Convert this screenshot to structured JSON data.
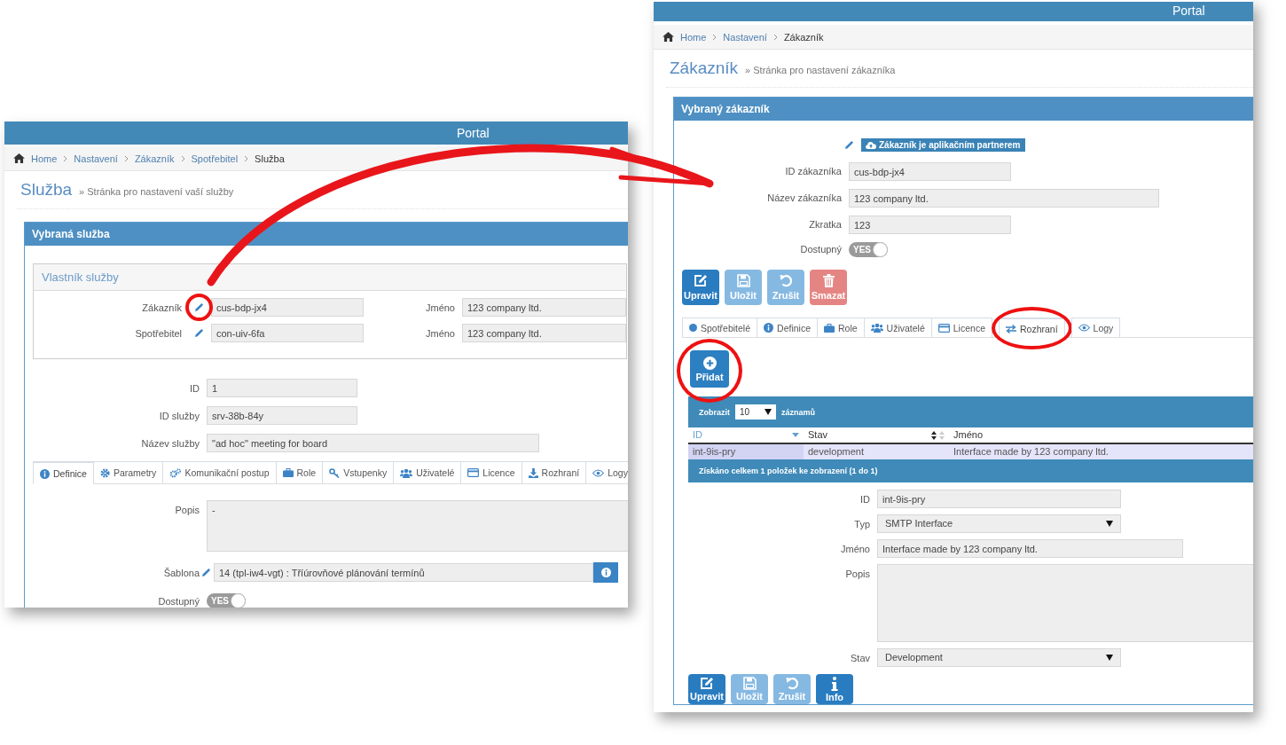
{
  "left_window": {
    "header": {
      "title": "Portal"
    },
    "breadcrumb": [
      {
        "label": "Home",
        "current": false
      },
      {
        "label": "Nastavení",
        "current": false
      },
      {
        "label": "Zákazník",
        "current": false
      },
      {
        "label": "Spotřebitel",
        "current": false
      },
      {
        "label": "Služba",
        "current": true
      }
    ],
    "page_title": "Služba",
    "page_subtitle": "» Stránka pro nastavení vaší služby",
    "panel_title": "Vybraná služba",
    "owner": {
      "title": "Vlastník služby",
      "rows": [
        {
          "label": "Zákazník",
          "value": "cus-bdp-jx4",
          "name_label": "Jméno",
          "name_value": "123 company ltd.",
          "circled": true
        },
        {
          "label": "Spotřebitel",
          "value": "con-uiv-6fa",
          "name_label": "Jméno",
          "name_value": "123 company ltd.",
          "circled": false
        }
      ]
    },
    "fields": [
      {
        "label": "ID",
        "value": "1"
      },
      {
        "label": "ID služby",
        "value": "srv-38b-84y"
      },
      {
        "label": "Název služby",
        "value": "\"ad hoc\" meeting for board"
      }
    ],
    "tabs": [
      {
        "label": "Definice",
        "selected": true
      },
      {
        "label": "Parametry",
        "selected": false
      },
      {
        "label": "Komunikační postup",
        "selected": false
      },
      {
        "label": "Role",
        "selected": false
      },
      {
        "label": "Vstupenky",
        "selected": false
      },
      {
        "label": "Uživatelé",
        "selected": false
      },
      {
        "label": "Licence",
        "selected": false
      },
      {
        "label": "Rozhraní",
        "selected": false
      },
      {
        "label": "Logy",
        "selected": false
      }
    ],
    "description": {
      "label": "Popis",
      "value": "-"
    },
    "template": {
      "label": "Šablona",
      "value": "14 (tpl-iw4-vgt) : Tříúrovňové plánování termínů"
    },
    "available": {
      "label": "Dostupný",
      "text": "YES",
      "on": true
    }
  },
  "right_window": {
    "header": {
      "title": "Portal"
    },
    "breadcrumb": [
      {
        "label": "Home",
        "current": false
      },
      {
        "label": "Nastavení",
        "current": false
      },
      {
        "label": "Zákazník",
        "current": true
      }
    ],
    "page_title": "Zákazník",
    "page_subtitle": "» Stránka pro nastavení zákazníka",
    "panel_title": "Vybraný zákazník",
    "partner_badge": "Zákazník je aplikačním partnerem",
    "fields": [
      {
        "label": "ID zákazníka",
        "value": "cus-bdp-jx4"
      },
      {
        "label": "Název zákazníka",
        "value": "123 company ltd."
      },
      {
        "label": "Zkratka",
        "value": "123"
      }
    ],
    "available": {
      "label": "Dostupný",
      "text": "YES",
      "on": true
    },
    "actions": [
      {
        "label": "Upravit",
        "kind": "primary",
        "disabled": false
      },
      {
        "label": "Uložit",
        "kind": "primary",
        "disabled": true
      },
      {
        "label": "Zrušit",
        "kind": "primary",
        "disabled": true
      },
      {
        "label": "Smazat",
        "kind": "danger",
        "disabled": true
      }
    ],
    "tabs": [
      {
        "label": "Spotřebitelé",
        "selected": false,
        "circled": false
      },
      {
        "label": "Definice",
        "selected": false,
        "circled": false
      },
      {
        "label": "Role",
        "selected": false,
        "circled": false
      },
      {
        "label": "Uživatelé",
        "selected": false,
        "circled": false
      },
      {
        "label": "Licence",
        "selected": false,
        "circled": false
      },
      {
        "label": "Rozhraní",
        "selected": true,
        "circled": true
      },
      {
        "label": "Logy",
        "selected": false,
        "circled": false
      }
    ],
    "add_button": {
      "label": "Přidat",
      "circled": true
    },
    "table": {
      "length_label": "Zobrazit",
      "length_value": "10",
      "length_suffix": "záznamů",
      "columns": [
        {
          "label": "ID",
          "sorted": true
        },
        {
          "label": "Stav",
          "sorted": false,
          "sortable": true
        },
        {
          "label": "Jméno",
          "sorted": false,
          "sortable": false
        }
      ],
      "rows": [
        {
          "cells": [
            "int-9is-pry",
            "development",
            "Interface made by 123 company ltd."
          ],
          "selected": true
        }
      ],
      "info": "Získáno celkem 1 položek ke zobrazení (1 do 1)"
    },
    "detail_fields": [
      {
        "label": "ID",
        "value": "int-9is-pry",
        "kind": "text"
      },
      {
        "label": "Typ",
        "value": "SMTP Interface",
        "kind": "select"
      },
      {
        "label": "Jméno",
        "value": "Interface made by 123 company ltd.",
        "kind": "text"
      },
      {
        "label": "Popis",
        "kind": "textarea"
      },
      {
        "label": "Stav",
        "value": "Development",
        "kind": "select"
      }
    ],
    "detail_actions": [
      {
        "label": "Upravit",
        "kind": "primary",
        "disabled": false
      },
      {
        "label": "Uložit",
        "kind": "primary",
        "disabled": true
      },
      {
        "label": "Zrušit",
        "kind": "primary",
        "disabled": true
      },
      {
        "label": "Info",
        "kind": "primary",
        "disabled": false
      }
    ]
  }
}
